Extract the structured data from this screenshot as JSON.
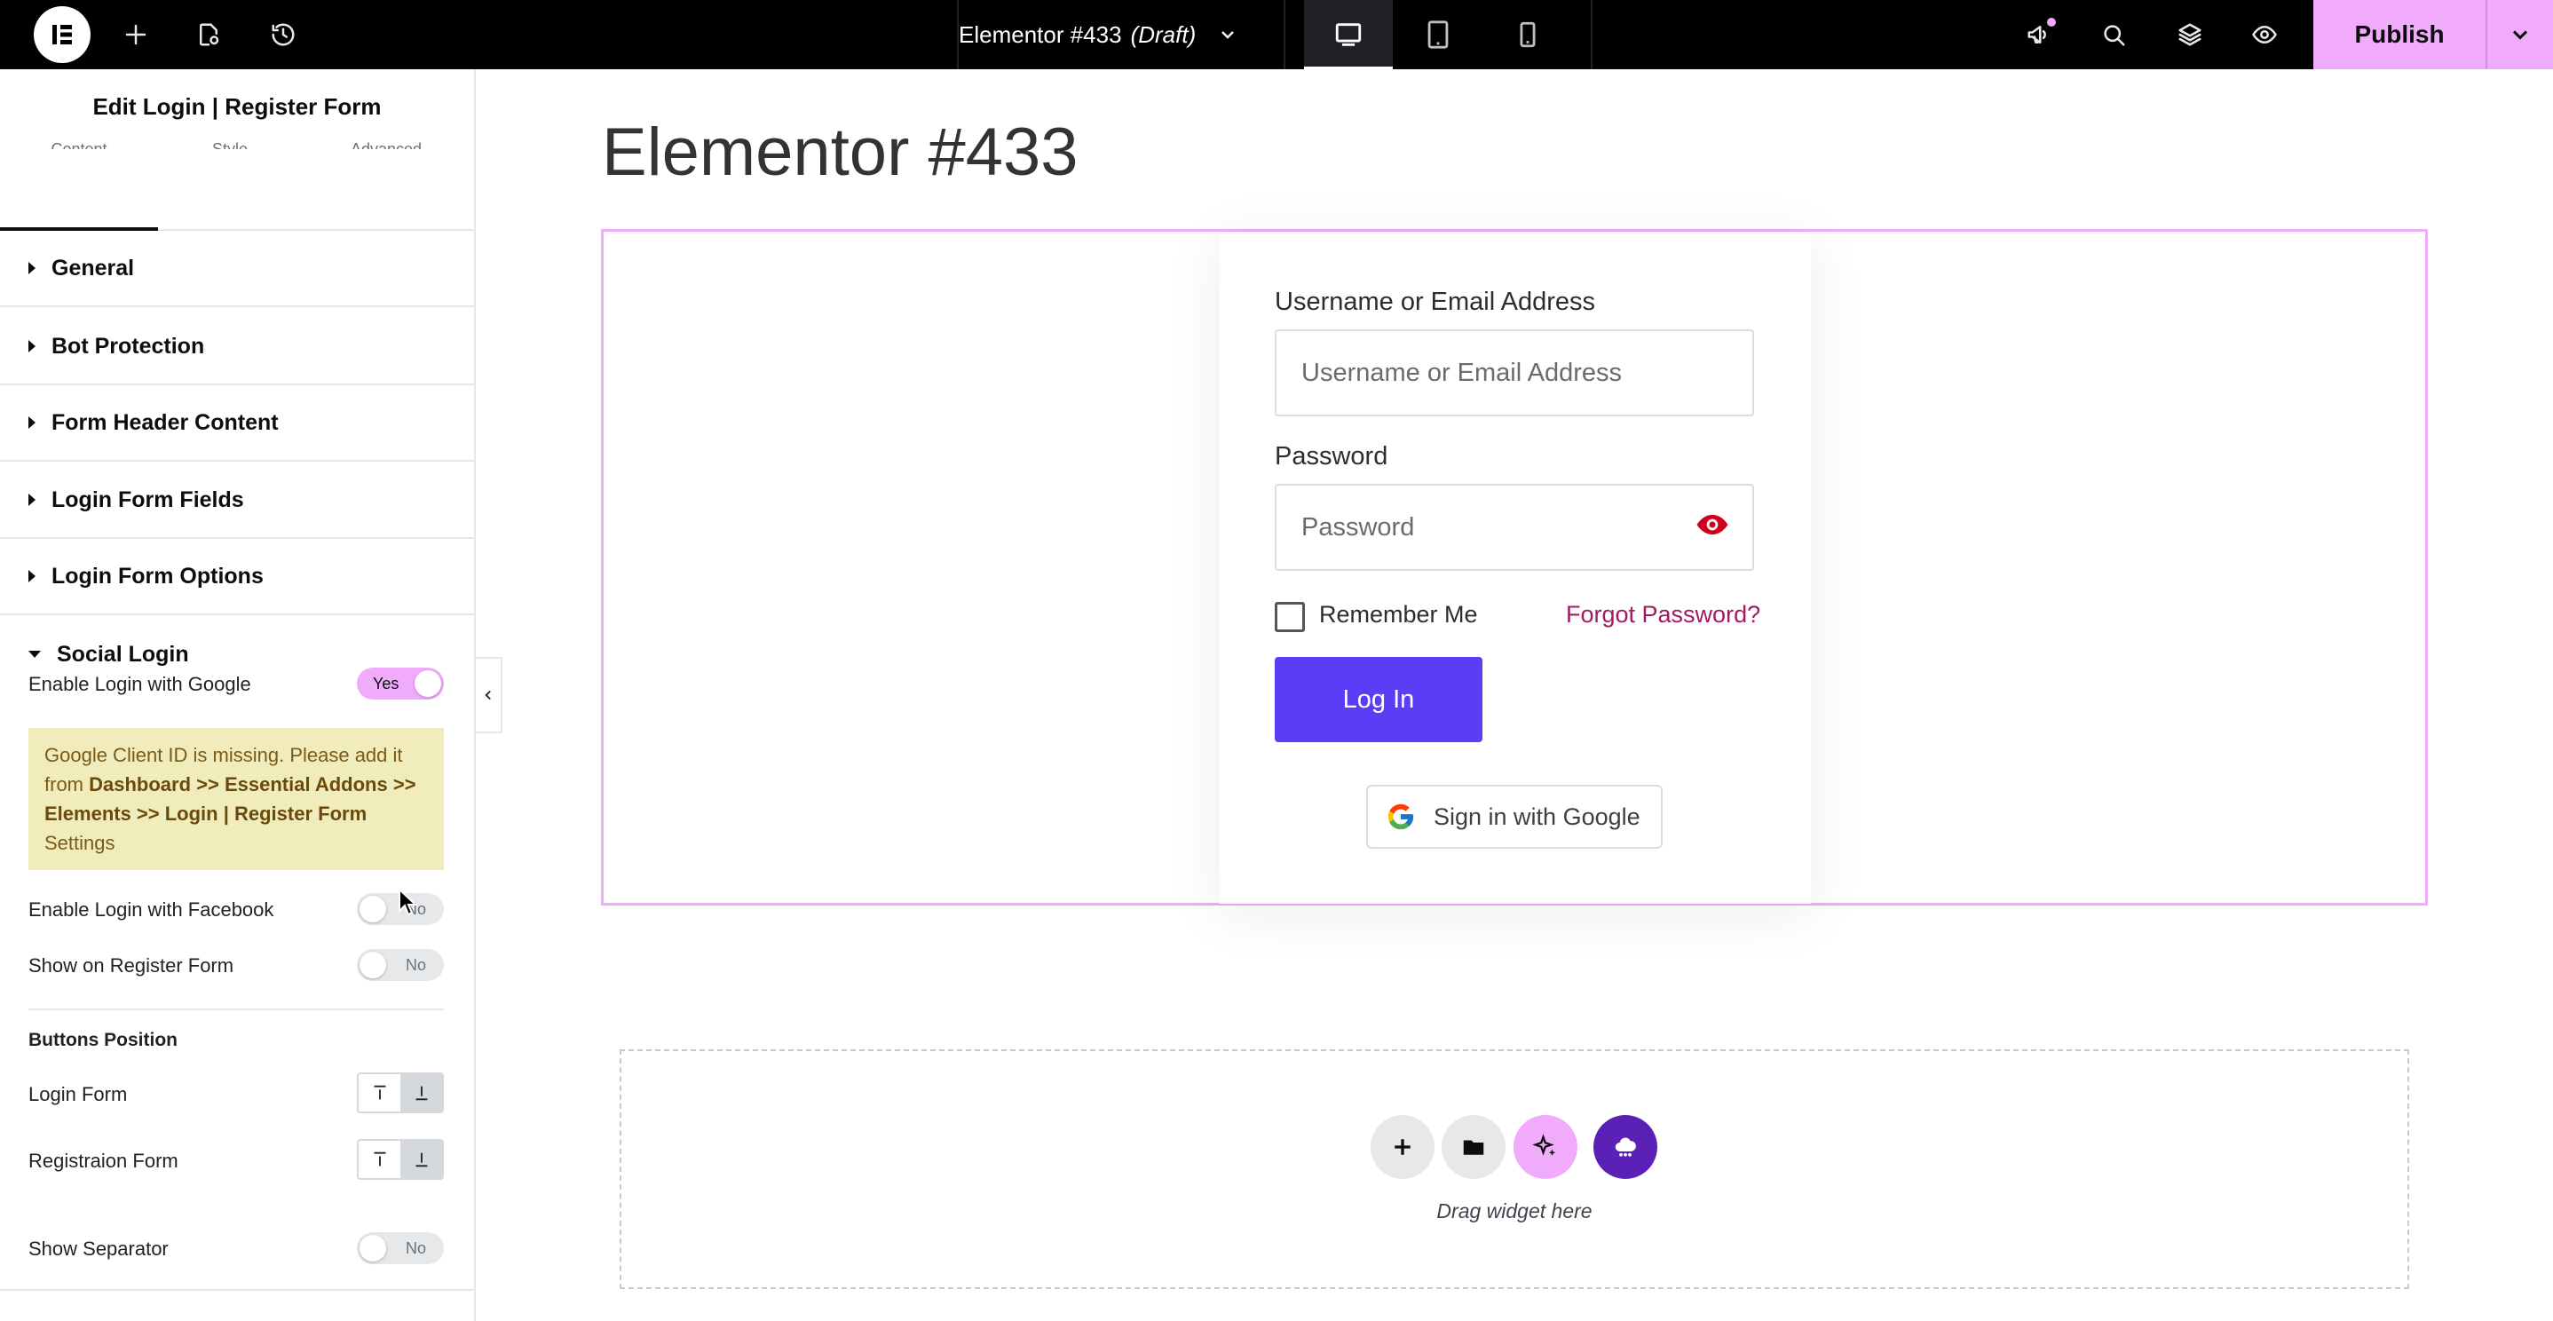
{
  "topbar": {
    "document_title": "Elementor #433",
    "document_status": "(Draft)",
    "publish_label": "Publish",
    "icons": [
      "elementor-logo-icon",
      "add-element-icon",
      "page-settings-icon",
      "history-icon",
      "chevron-down-icon",
      "desktop-icon",
      "tablet-icon",
      "mobile-icon",
      "whats-new-icon",
      "search-icon",
      "structure-layers-icon",
      "preview-eye-icon"
    ],
    "active_device": "desktop"
  },
  "panel": {
    "title": "Edit Login | Register Form",
    "tabs": [
      "Content",
      "Style",
      "Advanced"
    ],
    "sections": [
      "General",
      "Bot Protection",
      "Form Header Content",
      "Login Form Fields",
      "Login Form Options",
      "Social Login"
    ],
    "open_section": "Social Login",
    "social": {
      "google_label": "Enable Login with Google",
      "google_value": "Yes",
      "notice_text_1": "Google Client ID is missing. Please add it from ",
      "notice_bold": "Dashboard >> Essential Addons >> Elements >> Login | Register Form",
      "notice_text_2": " Settings",
      "facebook_label": "Enable Login with Facebook",
      "facebook_value": "No",
      "register_label": "Show on Register Form",
      "register_value": "No",
      "buttons_position_heading": "Buttons Position",
      "login_form_label": "Login Form",
      "registration_form_label": "Registraion Form",
      "separator_label": "Show Separator",
      "separator_value": "No"
    }
  },
  "canvas": {
    "page_title": "Elementor #433",
    "form": {
      "username_label": "Username or Email Address",
      "username_placeholder": "Username or Email Address",
      "password_label": "Password",
      "password_placeholder": "Password",
      "remember_label": "Remember Me",
      "forgot_label": "Forgot Password?",
      "login_button": "Log In",
      "google_button": "Sign in with Google"
    },
    "dropzone_text": "Drag widget here"
  },
  "colors": {
    "accent_pink": "#f0abfc",
    "login_button": "#5c3df5",
    "forgot_link": "#a21b62",
    "eye_icon": "#d0021b",
    "notice_bg": "#f1ecbb"
  }
}
